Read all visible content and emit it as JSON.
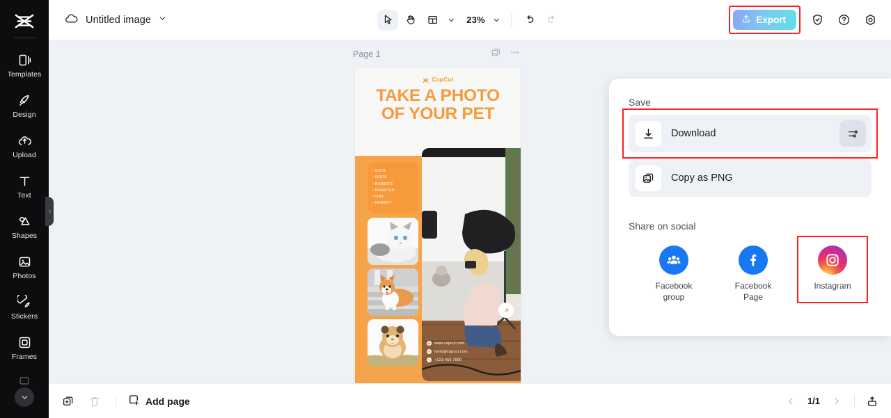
{
  "sidebar": {
    "logo_icon": "capcut-logo-icon",
    "items": [
      {
        "label": "Templates",
        "icon": "templates-icon"
      },
      {
        "label": "Design",
        "icon": "design-icon"
      },
      {
        "label": "Upload",
        "icon": "upload-cloud-icon"
      },
      {
        "label": "Text",
        "icon": "text-t-icon"
      },
      {
        "label": "Shapes",
        "icon": "shapes-icon"
      },
      {
        "label": "Photos",
        "icon": "photos-image-icon"
      },
      {
        "label": "Stickers",
        "icon": "stickers-icon"
      },
      {
        "label": "Frames",
        "icon": "frames-icon"
      }
    ],
    "expand_icon": "chevron-down-icon",
    "collapse_handle_icon": "chevron-right-icon"
  },
  "topbar": {
    "cloud_icon": "cloud-saved-icon",
    "document_title": "Untitled image",
    "title_dropdown_icon": "chevron-down-icon",
    "tools": [
      {
        "name": "select-tool",
        "icon": "cursor-arrow-icon",
        "active": true
      },
      {
        "name": "hand-tool",
        "icon": "hand-icon",
        "active": false
      },
      {
        "name": "layout-tool",
        "icon": "layout-grid-icon",
        "active": false
      }
    ],
    "zoom_level": "23%",
    "undo_icon": "undo-arrow-icon",
    "redo_icon": "redo-arrow-icon",
    "export_label": "Export",
    "export_icon": "export-upload-icon",
    "export_gradient_from": "#8ea2f5",
    "export_gradient_to": "#62dfe8",
    "right_icons": [
      {
        "name": "shield-check-icon"
      },
      {
        "name": "help-question-icon"
      },
      {
        "name": "settings-gear-icon"
      }
    ]
  },
  "canvas": {
    "page_label": "Page 1",
    "page_icons": [
      {
        "name": "duplicate-page-icon"
      },
      {
        "name": "more-options-icon"
      }
    ],
    "poster": {
      "brand": "CapCut",
      "title_line1": "TAKE A PHOTO",
      "title_line2": "OF YOUR PET",
      "pet_list": [
        "CATS",
        "DOGS",
        "RABBITS",
        "HAMSTER",
        "OWL",
        "PARROT"
      ],
      "thumbnails": [
        "cat-photo",
        "corgi-dog-photo",
        "hamster-photo"
      ],
      "main_photo": "photographer-shooting-pet-in-studio",
      "arrow_icon": "arrow-up-right-icon",
      "contacts": [
        {
          "icon": "globe-icon",
          "text": "www.capcut.com"
        },
        {
          "icon": "mail-icon",
          "text": "hello@capcut.com"
        },
        {
          "icon": "phone-icon",
          "text": "+123-456-7890"
        }
      ],
      "accent_color": "#f79a3b"
    }
  },
  "export_panel": {
    "save_label": "Save",
    "download_label": "Download",
    "download_icon": "download-arrow-icon",
    "download_settings_icon": "sliders-settings-icon",
    "copy_png_label": "Copy as PNG",
    "copy_png_icon": "copy-image-icon",
    "share_label": "Share on social",
    "socials": [
      {
        "label": "Facebook\ngroup",
        "line1": "Facebook",
        "line2": "group",
        "icon": "facebook-group-icon",
        "highlighted": false
      },
      {
        "label": "Facebook\nPage",
        "line1": "Facebook",
        "line2": "Page",
        "icon": "facebook-page-icon",
        "highlighted": false
      },
      {
        "label": "Instagram",
        "line1": "Instagram",
        "line2": "",
        "icon": "instagram-icon",
        "highlighted": true
      }
    ],
    "highlight_color": "#ff1f1f"
  },
  "bottombar": {
    "duplicate_icon": "duplicate-page-icon",
    "delete_icon": "trash-delete-icon",
    "add_page_label": "Add page",
    "add_page_icon": "add-page-plus-icon",
    "prev_icon": "chevron-left-icon",
    "next_icon": "chevron-right-icon",
    "page_counter": "1/1",
    "export_bottom_icon": "export-upload-icon"
  }
}
